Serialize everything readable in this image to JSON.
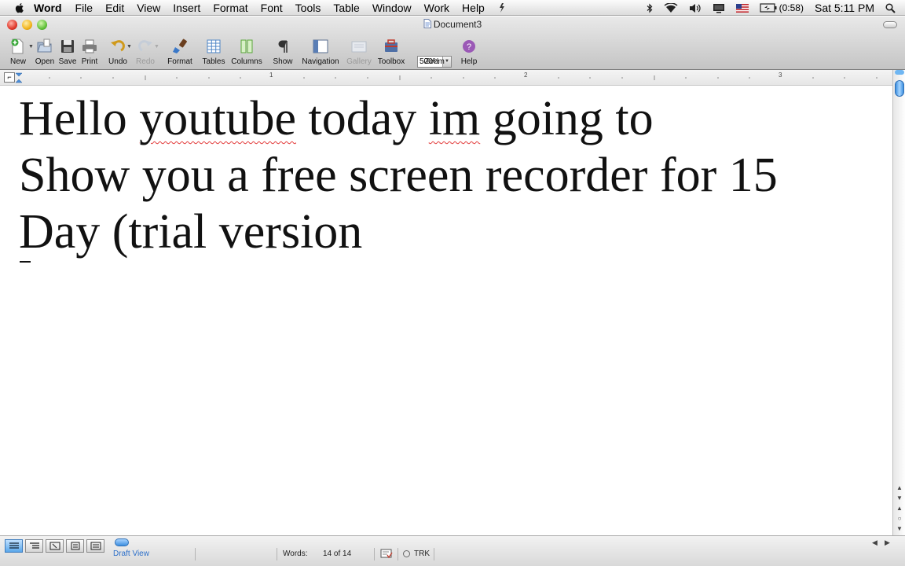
{
  "menubar": {
    "app_name": "Word",
    "menus": [
      "File",
      "Edit",
      "View",
      "Insert",
      "Format",
      "Font",
      "Tools",
      "Table",
      "Window",
      "Work",
      "Help"
    ],
    "battery": "(0:58)",
    "clock": "Sat 5:11 PM",
    "icons": [
      "apple-icon",
      "script-icon",
      "bluetooth-icon",
      "wifi-icon",
      "volume-icon",
      "display-icon",
      "flag-icon",
      "battery-icon",
      "spotlight-icon"
    ]
  },
  "window": {
    "title": "Document3"
  },
  "toolbar": {
    "new": "New",
    "open": "Open",
    "save": "Save",
    "print": "Print",
    "undo": "Undo",
    "redo": "Redo",
    "format": "Format",
    "tables": "Tables",
    "columns": "Columns",
    "show": "Show",
    "navigation": "Navigation",
    "gallery": "Gallery",
    "toolbox": "Toolbox",
    "zoom_value": "500%",
    "zoom": "Zoom",
    "help": "Help"
  },
  "ruler": {
    "numbers": [
      "1",
      "2",
      "3"
    ]
  },
  "document": {
    "line1": {
      "w1": "Hello",
      "w2": "youtube",
      "w3": "today",
      "w4": "im",
      "w5": "going to"
    },
    "line2": "Show you a free screen recorder for 15",
    "line3": "Day (trial version"
  },
  "statusbar": {
    "view_label": "Draft View",
    "words_label": "Words:",
    "words_value": "14 of 14",
    "track": "TRK"
  },
  "colors": {
    "spell_underline": "#e23a3a",
    "accent": "#3b8fe0"
  }
}
